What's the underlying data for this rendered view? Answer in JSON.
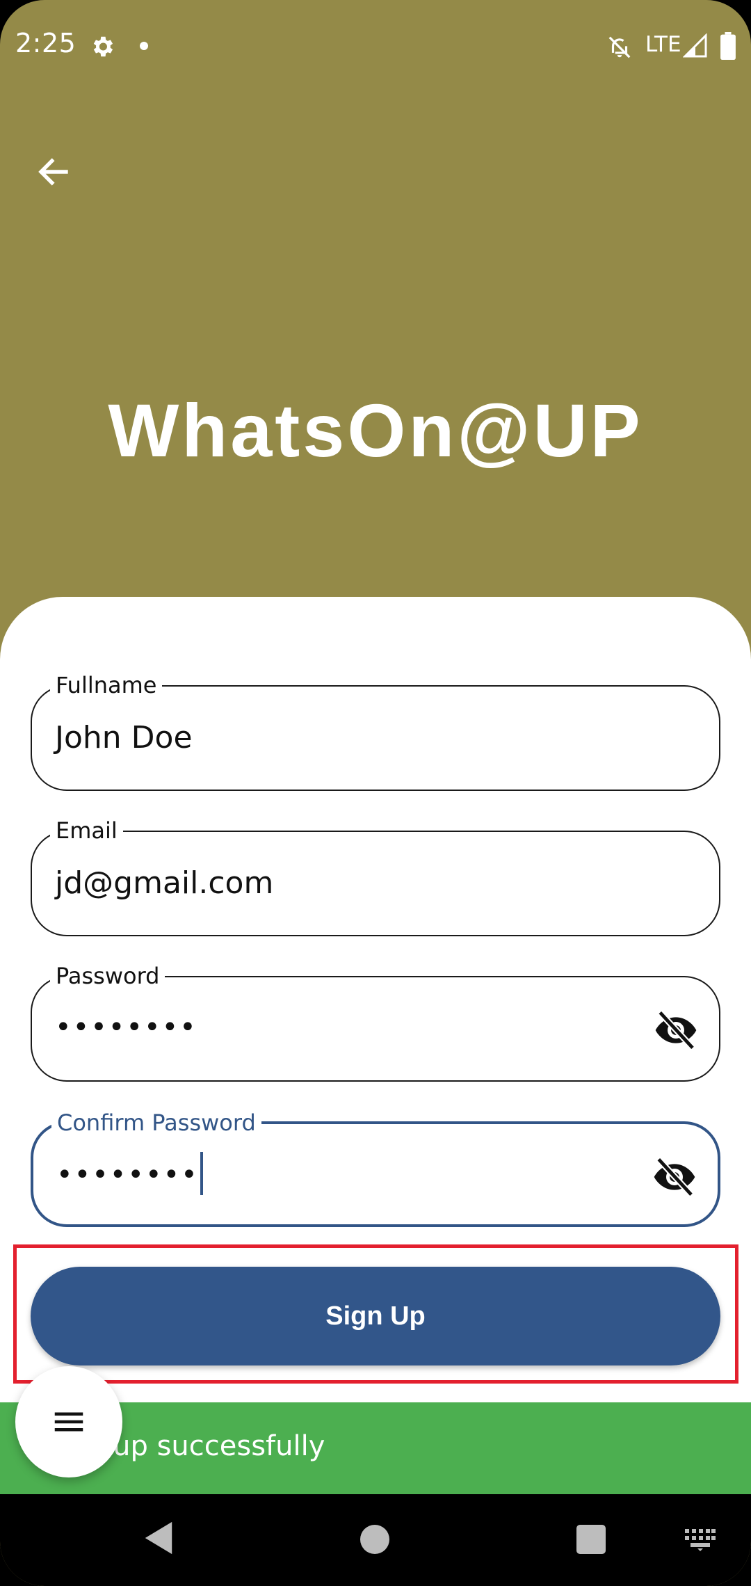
{
  "status_bar": {
    "time": "2:25",
    "network": "LTE",
    "icons": [
      "gear-icon",
      "notification-dot-icon",
      "bell-off-icon",
      "signal-icon",
      "battery-icon"
    ]
  },
  "header": {
    "back_icon": "arrow-left-icon",
    "title": "WhatsOn@UP",
    "background_color": "#948a48"
  },
  "form": {
    "fields": [
      {
        "label": "Fullname",
        "value": "John Doe"
      },
      {
        "label": "Email",
        "value": "jd@gmail.com"
      },
      {
        "label": "Password",
        "value": "••••••••",
        "toggle_icon": "eye-off-icon"
      },
      {
        "label": "Confirm Password",
        "value": "••••••••",
        "toggle_icon": "eye-off-icon",
        "focused": true
      }
    ],
    "submit_label": "Sign Up",
    "accent_color": "#32568a"
  },
  "snackbar": {
    "text": "d up successfully",
    "color": "#4caf50"
  },
  "fab": {
    "icon": "menu-icon"
  },
  "nav_bar": {
    "icons": [
      "nav-back-icon",
      "nav-home-icon",
      "nav-recents-icon",
      "keyboard-icon"
    ]
  }
}
